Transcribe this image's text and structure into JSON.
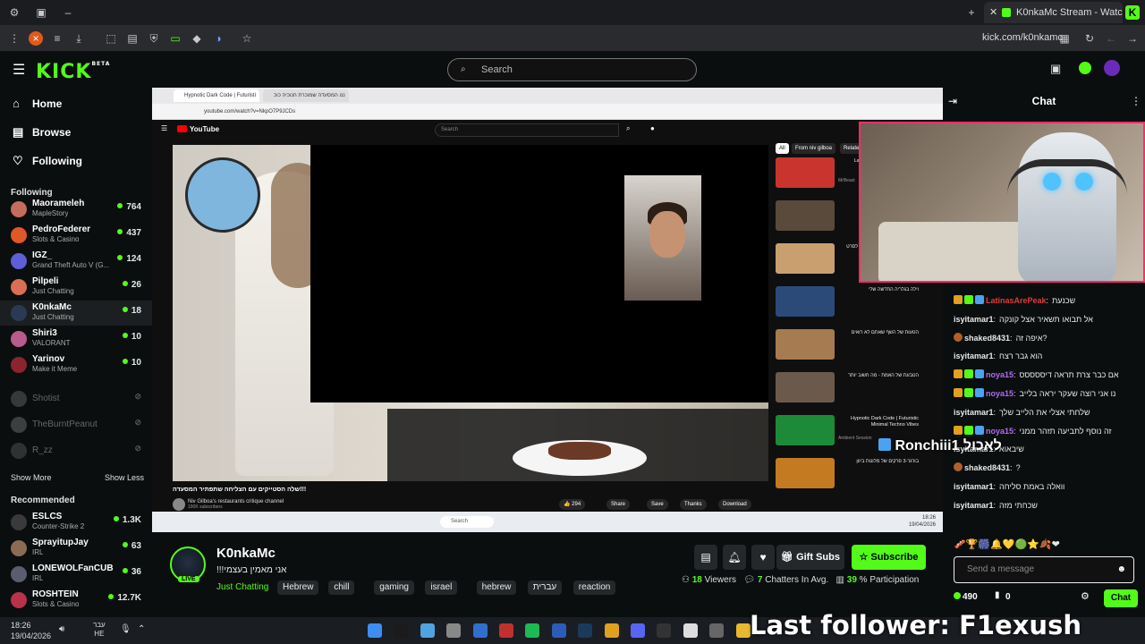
{
  "browser": {
    "tab_title": "K0nkaMc Stream - Watch L",
    "url": "kick.com/k0nkamc"
  },
  "header": {
    "logo": "KICK",
    "logo_badge": "BETA",
    "search_placeholder": "Search"
  },
  "sidebar": {
    "nav": [
      {
        "label": "Home",
        "icon": "home-icon"
      },
      {
        "label": "Browse",
        "icon": "browse-icon"
      },
      {
        "label": "Following",
        "icon": "heart-icon"
      }
    ],
    "following_title": "Following",
    "following": [
      {
        "name": "Maorameleh",
        "category": "MapleStory",
        "viewers": "764",
        "color": "#c46d5e"
      },
      {
        "name": "PedroFederer",
        "category": "Slots & Casino",
        "viewers": "437",
        "color": "#e2572a"
      },
      {
        "name": "IGZ_",
        "category": "Grand Theft Auto V (G...",
        "viewers": "124",
        "color": "#5e5ed8"
      },
      {
        "name": "Pilpeli",
        "category": "Just Chatting",
        "viewers": "26",
        "color": "#d96f54"
      },
      {
        "name": "K0nkaMc",
        "category": "Just Chatting",
        "viewers": "18",
        "color": "#2a3a55"
      },
      {
        "name": "Shiri3",
        "category": "VALORANT",
        "viewers": "10",
        "color": "#b85c8c"
      },
      {
        "name": "Yarinov",
        "category": "Make it Meme",
        "viewers": "10",
        "color": "#8a2430"
      }
    ],
    "offline": [
      {
        "name": "Shotist",
        "color": "#777"
      },
      {
        "name": "TheBurntPeanut",
        "color": "#888"
      },
      {
        "name": "R_zz",
        "color": "#666"
      }
    ],
    "show_more": "Show More",
    "show_less": "Show Less",
    "recommended_title": "Recommended",
    "recommended": [
      {
        "name": "ESLCS",
        "category": "Counter-Strike 2",
        "viewers": "1.3K",
        "color": "#3a3a3a"
      },
      {
        "name": "SprayitupJay",
        "category": "IRL",
        "viewers": "63",
        "color": "#8c6b54"
      },
      {
        "name": "LONEWOLFanCUB",
        "category": "IRL",
        "viewers": "36",
        "color": "#5c5c70"
      },
      {
        "name": "ROSHTEIN",
        "category": "Slots & Casino",
        "viewers": "12.7K",
        "color": "#b8324a"
      }
    ]
  },
  "stream_window": {
    "tabs": [
      "Hypnotic Dark Code | Futuristi",
      "ננו המסעדה שמוכרת חנוכיה כוכ"
    ],
    "url": "youtube.com/watch?v=NkpO7P9JCDs",
    "yt_logo": "YouTube",
    "yt_search": "Search",
    "video_title": "!!!שלה הסטייקים עם הצליחה שתפתיר המסעדה",
    "channel": "Niv Gilboa's restaurants critique channel",
    "subscribers": "190K subscribers",
    "actions": {
      "like": "294",
      "share": "Share",
      "save": "Save",
      "thanks": "Thanks",
      "download": "Download"
    },
    "side_chips": [
      "All",
      "From niv gilboa",
      "Related"
    ],
    "recommendations": [
      {
        "title": "Last To Leave Wins $250,000",
        "channel": "MrBeast",
        "color": "#c9352e"
      },
      {
        "title": "",
        "channel": "",
        "color": "#5a4a3c"
      },
      {
        "title": "היי צבא - הדמויות שלא נכנסו לסרט",
        "channel": "",
        "color": "#c8a070"
      },
      {
        "title": "וילה בגלריה החדשה שלי",
        "channel": "",
        "color": "#2c4a78"
      },
      {
        "title": "הטעות של השף שאתם לא רואים",
        "channel": "",
        "color": "#a77b52"
      },
      {
        "title": "הטבעת של האמת - מה חשוב יותר",
        "channel": "",
        "color": "#6b5a4c"
      },
      {
        "title": "Hypnotic Dark Code | Futuristic Minimal Techno Vibes",
        "channel": "Ambient Session",
        "color": "#1d8a3a"
      },
      {
        "title": "בורגר-3 פרקים של מלונות ביוון",
        "channel": "",
        "color": "#c47a20"
      }
    ],
    "taskbar_search": "Search",
    "taskbar_time": "18:26",
    "taskbar_date": "19/04/2026"
  },
  "stream_info": {
    "streamer": "K0nkaMc",
    "live": "LIVE",
    "title": "!!!אני מאמין בעצמי",
    "category": "Just Chatting",
    "tags": [
      "Hebrew",
      "chill",
      "gaming",
      "israel",
      "hebrew",
      "עברית",
      "reaction"
    ],
    "gift_subs": "Gift Subs",
    "subscribe": "Subscribe",
    "viewers_count": "18",
    "viewers_label": "Viewers",
    "chatters_count": "7",
    "chatters_label": "Chatters In Avg.",
    "participation_count": "39",
    "participation_label": "% Participation"
  },
  "chat": {
    "title": "Chat",
    "overlay_name": "Ronchiii1",
    "overlay_text": "לאכול",
    "messages": [
      {
        "user": "LatinasArePeak",
        "text": "שכנעת",
        "color": "#e03a3a"
      },
      {
        "user": "isyitamar1",
        "text": "אל תבואו תשאיר אצל קונקה",
        "color": "#e8e8e8"
      },
      {
        "user": "shaked8431",
        "text": "איפה זה?",
        "color": "#e8e8e8"
      },
      {
        "user": "isyitamar1",
        "text": "הוא גבר רצח",
        "color": "#e8e8e8"
      },
      {
        "user": "noya15",
        "text": "אם כבר צרת תראה דיססססס",
        "color": "#b06bf0"
      },
      {
        "user": "noya15",
        "text": "נו אני רוצה שעקר יראה בלייב",
        "color": "#b06bf0"
      },
      {
        "user": "isyitamar1",
        "text": "שלחתי אצלי את הלייב שלך",
        "color": "#e8e8e8"
      },
      {
        "user": "noya15",
        "text": "זה נוסף לתביעה תזהר ממני",
        "color": "#b06bf0"
      },
      {
        "user": "isyitamar1",
        "text": "שיבאוא",
        "color": "#e8e8e8"
      },
      {
        "user": "shaked8431",
        "text": "?",
        "color": "#e8e8e8"
      },
      {
        "user": "isyitamar1",
        "text": "וואלה באמת סליחה",
        "color": "#e8e8e8"
      },
      {
        "user": "isyitamar1",
        "text": "שכחתי מזה",
        "color": "#e8e8e8"
      }
    ],
    "input_placeholder": "Send a message",
    "points": "490",
    "points2": "0",
    "chat_button": "Chat"
  },
  "os_taskbar": {
    "time": "18:26",
    "date": "19/04/2026",
    "lang": "עבר",
    "lang2": "HE"
  },
  "last_follower": "Last follower: F1exush",
  "colors": {
    "accent": "#53fc18",
    "webcam_border": "#ff2b6a"
  }
}
